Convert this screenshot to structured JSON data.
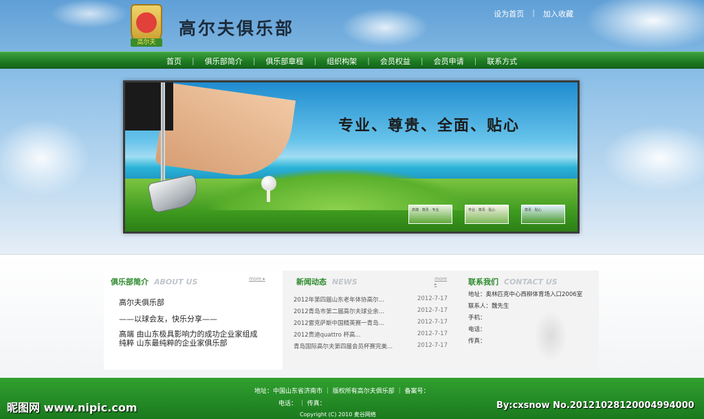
{
  "header": {
    "site_title": "高尔夫俱乐部",
    "logo_text": "高尔夫",
    "top_links": [
      "设为首页",
      "加入收藏"
    ]
  },
  "nav": {
    "items": [
      "首页",
      "俱乐部简介",
      "俱乐部章程",
      "组织构架",
      "会员权益",
      "会员申请",
      "联系方式"
    ]
  },
  "banner": {
    "slogan": "专业、尊贵、全面、贴心",
    "thumb_captions": [
      "高端 · 尊贵 · 专业",
      "专业 · 尊贵 · 贴心",
      "尊贵 · 贴心"
    ]
  },
  "club_intro": {
    "title": "俱乐部简介",
    "title_en": "ABOUT US",
    "more": "more",
    "line1": "高尔夫俱乐部",
    "line2": "——以球会友，快乐分享——",
    "line3": "高端 由山东极具影响力的成功企业家组成",
    "line4": "纯粹 山东最纯粹的企业家俱乐部"
  },
  "news": {
    "title": "新闻动态",
    "title_en": "NEWS",
    "more": "more",
    "items": [
      {
        "title": "2012年第四届山东老年体协高尔...",
        "date": "2012-7-17"
      },
      {
        "title": "2012青岛市第二届高尔夫球业余...",
        "date": "2012-7-17"
      },
      {
        "title": "2012雷克萨斯中国精英赛一青岛...",
        "date": "2012-7-17"
      },
      {
        "title": "2012贵迪quattro 杯高...",
        "date": "2012-7-17"
      },
      {
        "title": "青岛国际高尔夫第四届会员杯赛完美...",
        "date": "2012-7-17"
      }
    ]
  },
  "contact": {
    "title": "联系我们",
    "title_en": "CONTACT US",
    "items": [
      "地址：奥林匹克中心西柳体育场入口2006室",
      "联系人：魏先生",
      "手机：",
      "电话：",
      "传真："
    ]
  },
  "footer": {
    "line1": "地址：中国山东省济南市 ｜ 版权所有高尔夫俱乐部 ｜ 备案号：",
    "line2": "电话： ｜ 传真：",
    "line3": "Copyright (C) 2010 麦谷网络"
  },
  "watermark": {
    "left": "昵图网 www.nipic.com",
    "right": "By:cxsnow No.20121028120004994000"
  }
}
